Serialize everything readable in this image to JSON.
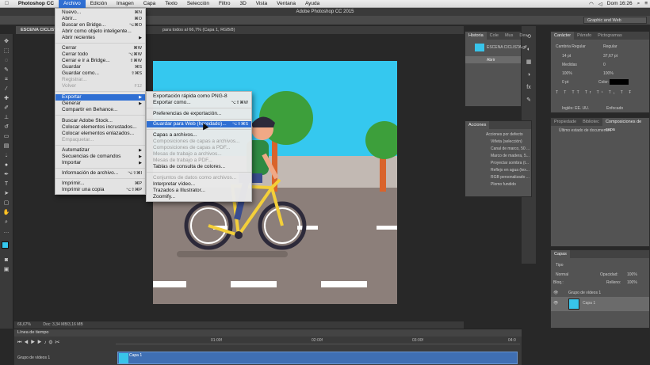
{
  "menubar": {
    "app": "Photoshop CC",
    "items": [
      "Archivo",
      "Edición",
      "Imagen",
      "Capa",
      "Texto",
      "Selección",
      "Filtro",
      "3D",
      "Vista",
      "Ventana",
      "Ayuda"
    ],
    "clock": "Dom 16:26"
  },
  "window": {
    "title": "Adobe Photoshop CC 2015",
    "workspace": "Graphic and Web"
  },
  "document": {
    "tab": "ESCENA CICLISTA.gif",
    "info": "para todos al 66,7% (Capa 1, RGB/8)",
    "zoom": "66,67%",
    "doc_size": "Doc: 3,34 MB/3,16 MB"
  },
  "file_menu": {
    "items": [
      {
        "label": "Nuevo...",
        "shortcut": "⌘N"
      },
      {
        "label": "Abrir...",
        "shortcut": "⌘O"
      },
      {
        "label": "Buscar en Bridge...",
        "shortcut": "⌥⌘O"
      },
      {
        "label": "Abrir como objeto inteligente...",
        "shortcut": ""
      },
      {
        "label": "Abrir recientes",
        "shortcut": "▶"
      },
      {
        "label": "Cerrar",
        "shortcut": "⌘W"
      },
      {
        "label": "Cerrar todo",
        "shortcut": "⌥⌘W"
      },
      {
        "label": "Cerrar e ir a Bridge...",
        "shortcut": "⇧⌘W"
      },
      {
        "label": "Guardar",
        "shortcut": "⌘S"
      },
      {
        "label": "Guardar como...",
        "shortcut": "⇧⌘S"
      },
      {
        "label": "Registrar...",
        "shortcut": ""
      },
      {
        "label": "Volver",
        "shortcut": "F12"
      },
      {
        "label": "Exportar",
        "shortcut": "▶"
      },
      {
        "label": "Generar",
        "shortcut": "▶"
      },
      {
        "label": "Compartir en Behance...",
        "shortcut": ""
      },
      {
        "label": "Buscar Adobe Stock...",
        "shortcut": ""
      },
      {
        "label": "Colocar elementos incrustados...",
        "shortcut": ""
      },
      {
        "label": "Colocar elementos enlazados...",
        "shortcut": ""
      },
      {
        "label": "Empaquetar...",
        "shortcut": ""
      },
      {
        "label": "Automatizar",
        "shortcut": "▶"
      },
      {
        "label": "Secuencias de comandos",
        "shortcut": "▶"
      },
      {
        "label": "Importar",
        "shortcut": "▶"
      },
      {
        "label": "Información de archivo...",
        "shortcut": "⌥⇧⌘I"
      },
      {
        "label": "Imprimir...",
        "shortcut": "⌘P"
      },
      {
        "label": "Imprimir una copia",
        "shortcut": "⌥⇧⌘P"
      }
    ]
  },
  "export_menu": {
    "items": [
      {
        "label": "Exportación rápida como PNG-8",
        "shortcut": ""
      },
      {
        "label": "Exportar como...",
        "shortcut": "⌥⇧⌘W"
      },
      {
        "label": "Preferencias de exportación...",
        "shortcut": ""
      },
      {
        "label": "Guardar para Web (heredado)...",
        "shortcut": "⌥⇧⌘S"
      },
      {
        "label": "Capas a archivos...",
        "shortcut": ""
      },
      {
        "label": "Composiciones de capas a archivos...",
        "shortcut": ""
      },
      {
        "label": "Composiciones de capas a PDF...",
        "shortcut": ""
      },
      {
        "label": "Mesas de trabajo a archivos...",
        "shortcut": ""
      },
      {
        "label": "Mesas de trabajo a PDF...",
        "shortcut": ""
      },
      {
        "label": "Tablas de consulta de colores...",
        "shortcut": ""
      },
      {
        "label": "Conjuntos de datos como archivos...",
        "shortcut": ""
      },
      {
        "label": "Interpretar vídeo...",
        "shortcut": ""
      },
      {
        "label": "Trazados a Illustrator...",
        "shortcut": ""
      },
      {
        "label": "Zoomify...",
        "shortcut": ""
      }
    ]
  },
  "history_panel": {
    "tabs": [
      "Historia",
      "Cole",
      "Mus",
      "Dev"
    ],
    "snapshot": "ESCENA CICLISTA.gif",
    "step": "Abrir"
  },
  "actions_panel": {
    "title": "Acciones",
    "items": [
      "Acciones por defecto",
      "Viñeta (selección)",
      "Canal de marco, 50 ...",
      "Marco de madera, 5...",
      "Proyectar sombra (t...",
      "Reflejo en agua (tex...",
      "RGB personalizado ...",
      "Plomo fundido"
    ]
  },
  "character_panel": {
    "tabs": [
      "Carácter",
      "Párrafo",
      "Pictogramas"
    ],
    "font": "Cambria Regular",
    "style": "Regular",
    "size": "14 pt",
    "leading": "37,67 pt",
    "kerning": "Medidas",
    "tracking": "0",
    "vscale": "100%",
    "hscale": "100%",
    "baseline": "0 pt",
    "color_label": "Color:",
    "lang": "Inglés: EE. UU.",
    "aa": "Enfocado"
  },
  "comps_panel": {
    "tabs": [
      "Propiedade",
      "Bibliotec",
      "Composiciones de capa"
    ],
    "item": "Último estado de documento"
  },
  "layers_panel": {
    "title": "Capas",
    "filter": "Tipo",
    "blend": "Normal",
    "opacity_label": "Opacidad:",
    "opacity": "100%",
    "lock_label": "Bloq.:",
    "fill_label": "Relleno:",
    "fill": "100%",
    "group": "Grupo de vídeos 1",
    "layer": "Capa 1"
  },
  "timeline": {
    "title": "Línea de tiempo",
    "ticks": [
      "01:00f",
      "02:00f",
      "03:00f",
      "04:0"
    ],
    "group": "Grupo de vídeos 1",
    "clip": "Capa 1"
  },
  "colors": {
    "menu_highlight": "#2f6fd3",
    "sky": "#35c8ef",
    "road": "#8c7f7a",
    "bike_frame": "#f3cf3a"
  }
}
